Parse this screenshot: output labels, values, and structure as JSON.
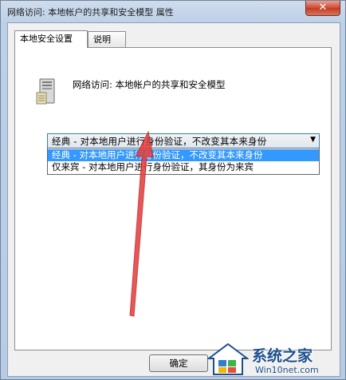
{
  "window": {
    "title": "网络访问: 本地帐户的共享和安全模型 属性",
    "close_glyph": "✕"
  },
  "tabs": [
    {
      "label": "本地安全设置",
      "active": true
    },
    {
      "label": "说明",
      "active": false
    }
  ],
  "policy": {
    "icon": "server-computer-icon",
    "title": "网络访问: 本地帐户的共享和安全模型"
  },
  "dropdown": {
    "selected_value": "经典 - 对本地用户进行身份验证，不改变其本来身份",
    "options": [
      "经典 - 对本地用户进行身份验证，不改变其本来身份",
      "仅来宾 - 对本地用户进行身份验证，其身份为来宾"
    ],
    "highlighted_index": 0
  },
  "buttons": {
    "ok_label": "确定"
  },
  "watermark": {
    "name": "系统之家",
    "url": "Win10net.com"
  },
  "colors": {
    "highlight": "#3399ff",
    "annotation_arrow": "#e23a3a",
    "watermark_text": "#1d4f8c"
  }
}
